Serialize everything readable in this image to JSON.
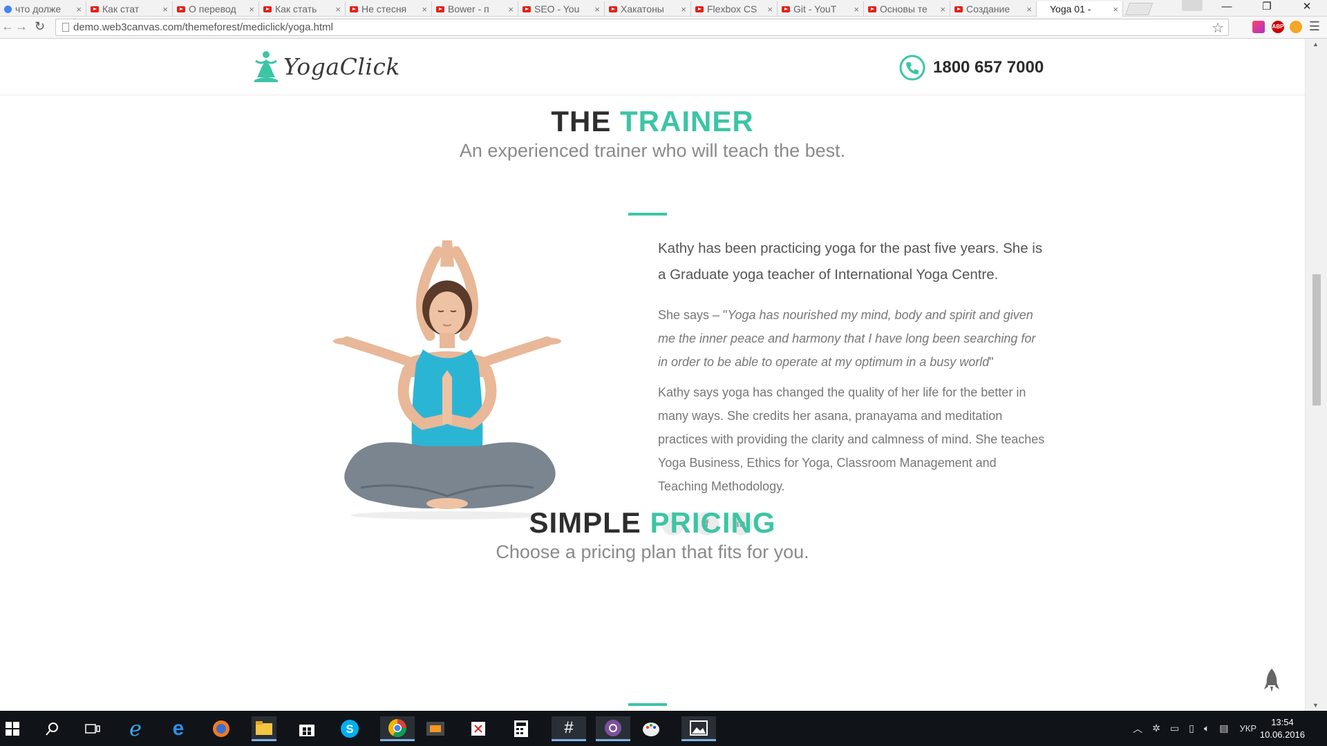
{
  "browser": {
    "tabs": [
      {
        "title": "что долже",
        "fav": "g"
      },
      {
        "title": "Как стат",
        "fav": "yt"
      },
      {
        "title": "О перевод",
        "fav": "yt"
      },
      {
        "title": "Как стать",
        "fav": "yt"
      },
      {
        "title": "Не стесня",
        "fav": "yt"
      },
      {
        "title": "Bower - п",
        "fav": "yt"
      },
      {
        "title": "SEO - You",
        "fav": "yt"
      },
      {
        "title": "Хакатоны",
        "fav": "yt"
      },
      {
        "title": "Flexbox CS",
        "fav": "yt"
      },
      {
        "title": "Git - YouT",
        "fav": "yt"
      },
      {
        "title": "Основы те",
        "fav": "yt"
      },
      {
        "title": "Создание",
        "fav": "yt"
      },
      {
        "title": "Yoga 01 -",
        "fav": "page",
        "active": true
      }
    ],
    "url": "demo.web3canvas.com/themeforest/mediclick/yoga.html",
    "extensions": [
      "ABP"
    ]
  },
  "site": {
    "logo_text": "YogaClick",
    "phone": "1800 657 7000"
  },
  "trainer": {
    "title_plain": "THE",
    "title_accent": "TRAINER",
    "subtitle": "An experienced trainer who will teach the best.",
    "lead": "Kathy has been practicing yoga for the past five years. She is a Graduate yoga teacher of International Yoga Centre.",
    "quote_prefix": "She says – \"",
    "quote": "Yoga has nourished my mind, body and spirit and given me the inner peace and harmony that I have long been searching for in order to be able to operate at my optimum in a busy world",
    "quote_suffix": "\"",
    "body": "Kathy says yoga has changed the quality of her life for the better in many ways. She credits her asana, pranayama and meditation practices with providing the clarity and calmness of mind. She teaches Yoga Business, Ethics for Yoga, Classroom Management and Teaching Methodology.",
    "socials": [
      {
        "icon": "twitter-icon",
        "glyph": "t"
      },
      {
        "icon": "facebook-icon",
        "glyph": "f"
      },
      {
        "icon": "linkedin-icon",
        "glyph": "in"
      }
    ]
  },
  "pricing": {
    "title_plain": "SIMPLE",
    "title_accent": "PRICING",
    "subtitle": "Choose a pricing plan that fits for you."
  },
  "taskbar": {
    "lang": "УКР",
    "time": "13:54",
    "date": "10.06.2016"
  },
  "colors": {
    "accent": "#3cc5a5",
    "heading": "#2e2e2e",
    "taskbar": "#101418"
  }
}
